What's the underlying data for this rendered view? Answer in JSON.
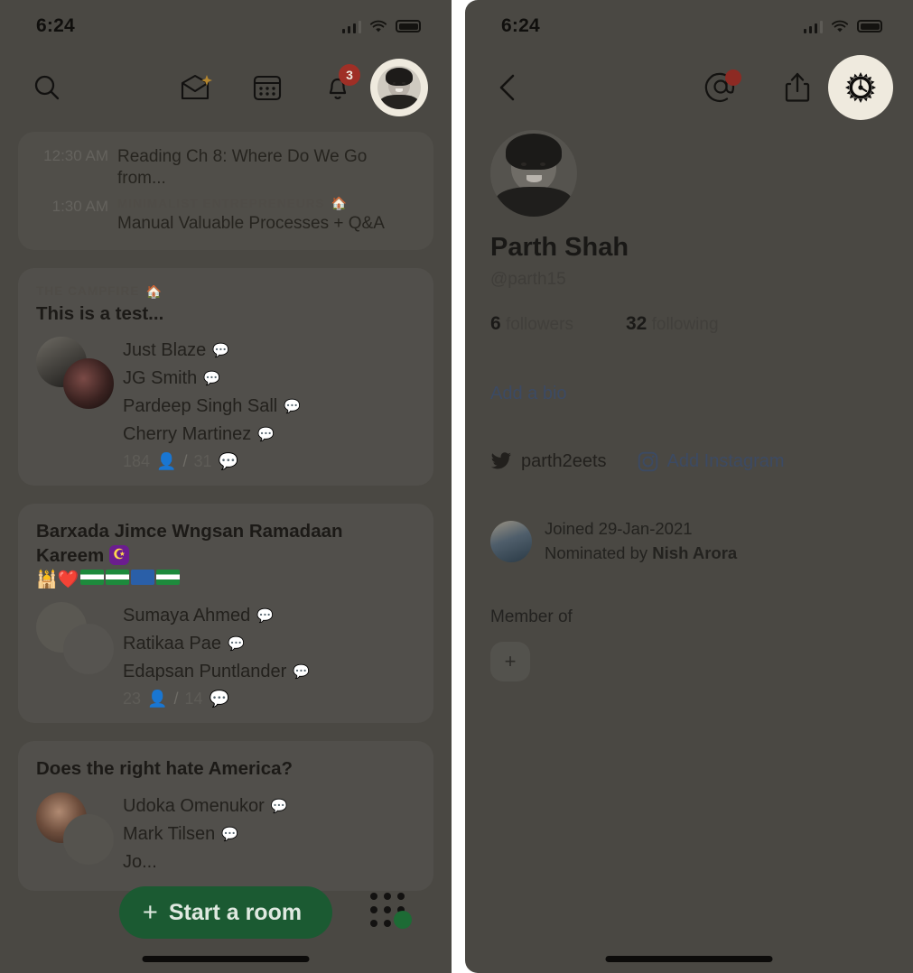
{
  "left_panel": {
    "status_bar": {
      "time": "6:24",
      "signal_icon": "cellular-signal-icon",
      "wifi_icon": "wifi-icon",
      "battery_icon": "battery-icon"
    },
    "nav": {
      "search_icon": "search-icon",
      "invite_icon": "invite-mail-icon",
      "calendar_icon": "calendar-icon",
      "bell_icon": "bell-icon",
      "bell_badge": "3",
      "avatar_icon": "profile-avatar"
    },
    "schedule_card": {
      "rows": [
        {
          "time": "12:30 AM",
          "club": "",
          "title": "Reading Ch 8: Where Do We Go from..."
        },
        {
          "time": "1:30 AM",
          "club": "MINIMALIST ENTREPRENEURS",
          "club_emoji": "🏠",
          "title": "Manual Valuable Processes + Q&A"
        }
      ]
    },
    "rooms": [
      {
        "club": "THE CAMPFIRE",
        "club_emoji": "🏠",
        "title": "This is a test...",
        "title_emoji": "",
        "speakers": [
          "Just Blaze",
          "JG Smith",
          "Pardeep Singh Sall",
          "Cherry Martinez"
        ],
        "listeners": "184",
        "speaking": "31"
      },
      {
        "club": "",
        "club_emoji": "",
        "title": "Barxada Jimce Wngsan Ramadaan Kareem",
        "title_emoji": "🕌❤️",
        "speakers": [
          "Sumaya Ahmed",
          "Ratikaa Pae",
          "Edapsan Puntlander"
        ],
        "listeners": "23",
        "speaking": "14"
      },
      {
        "club": "",
        "club_emoji": "",
        "title": "Does the right hate America?",
        "title_emoji": "",
        "speakers": [
          "Udoka Omenukor",
          "Mark Tilsen",
          "Jo..."
        ],
        "listeners": "",
        "speaking": ""
      }
    ],
    "start_room_button": {
      "plus": "+",
      "label": "Start a room"
    },
    "grid_dots_icon": "app-grid-icon"
  },
  "right_panel": {
    "status_bar": {
      "time": "6:24",
      "signal_icon": "cellular-signal-icon",
      "wifi_icon": "wifi-icon",
      "battery_icon": "battery-icon"
    },
    "nav": {
      "back_icon": "chevron-left-icon",
      "mention_icon": "at-mention-icon",
      "share_icon": "share-icon",
      "settings_icon": "gear-icon"
    },
    "profile": {
      "avatar_icon": "profile-avatar",
      "name": "Parth Shah",
      "handle": "@parth15",
      "followers_count": "6",
      "followers_label": "followers",
      "following_count": "32",
      "following_label": "following",
      "add_bio": "Add a bio",
      "twitter_icon": "twitter-icon",
      "twitter_handle": "parth2eets",
      "instagram_icon": "instagram-icon",
      "instagram_label": "Add Instagram",
      "joined_text": "Joined 29-Jan-2021",
      "nominated_prefix": "Nominated by ",
      "nominated_by": "Nish Arora",
      "member_of_label": "Member of",
      "add_club_button": "+"
    }
  },
  "colors": {
    "accent_green": "#1b5a32",
    "badge_red": "#9f2f26",
    "highlight_cream": "#efeade",
    "link_blue": "#3c4a63",
    "panel_bg": "#4a4843"
  }
}
